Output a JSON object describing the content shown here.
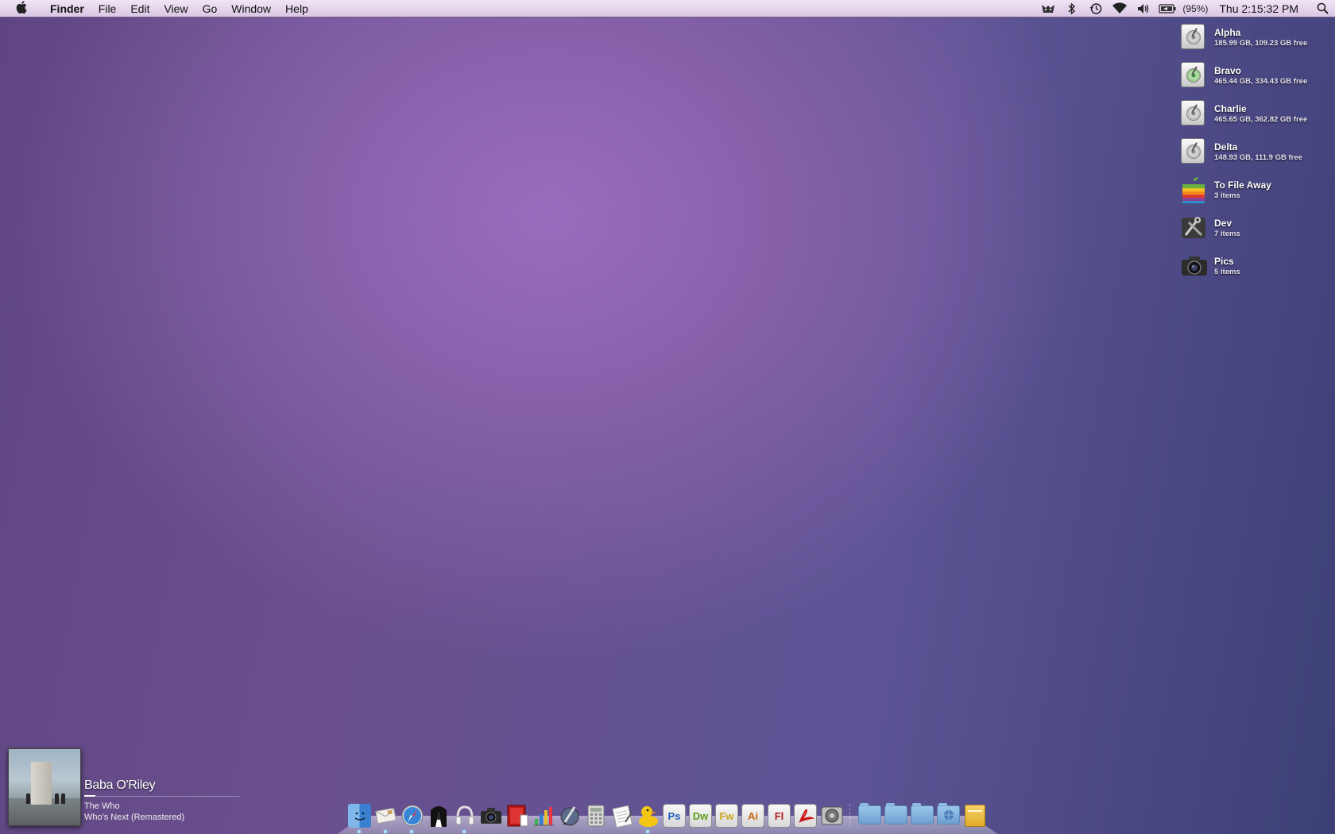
{
  "menubar": {
    "apple_icon": "apple-logo-icon",
    "menus": [
      "Finder",
      "File",
      "Edit",
      "View",
      "Go",
      "Window",
      "Help"
    ],
    "status": {
      "battery_percent": "(95%)",
      "clock": "Thu 2:15:32 PM"
    },
    "status_icons": [
      "growl-icon",
      "bluetooth-icon",
      "time-machine-icon",
      "wifi-icon",
      "volume-icon",
      "battery-icon",
      "spotlight-icon"
    ]
  },
  "desktop": {
    "items": [
      {
        "name": "Alpha",
        "info": "185.99 GB, 109.23 GB free",
        "icon": "hard-drive-icon"
      },
      {
        "name": "Bravo",
        "info": "465.44 GB, 334.43 GB free",
        "icon": "hard-drive-icon"
      },
      {
        "name": "Charlie",
        "info": "465.65 GB, 362.82 GB free",
        "icon": "hard-drive-icon"
      },
      {
        "name": "Delta",
        "info": "148.93 GB, 111.9 GB free",
        "icon": "hard-drive-icon"
      },
      {
        "name": "To File Away",
        "info": "3 items",
        "icon": "apple-folder-icon"
      },
      {
        "name": "Dev",
        "info": "7 items",
        "icon": "tools-folder-icon"
      },
      {
        "name": "Pics",
        "info": "5 items",
        "icon": "camera-folder-icon"
      }
    ]
  },
  "now_playing": {
    "title": "Baba O'Riley",
    "artist": "The Who",
    "album": "Who's Next (Remastered)",
    "progress": 0.07
  },
  "dock": {
    "apps": [
      "finder",
      "mail",
      "safari",
      "adium",
      "itunes",
      "camera",
      "photo-booth",
      "numbers",
      "script-editor",
      "calculator",
      "textedit",
      "cyberduck"
    ],
    "adobe": [
      {
        "label": "Ps",
        "color": "#1f5fb8"
      },
      {
        "label": "Dw",
        "color": "#5f9c1a"
      },
      {
        "label": "Fw",
        "color": "#c8a21a"
      },
      {
        "label": "Ai",
        "color": "#c46a12"
      },
      {
        "label": "Fl",
        "color": "#b51a1a"
      }
    ]
  }
}
